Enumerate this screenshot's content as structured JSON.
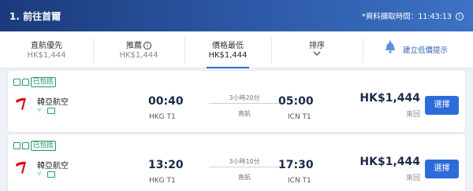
{
  "header": {
    "title": "1. 前往首爾",
    "fetch_time": "*資料擷取時間：11:43:13",
    "fetch_time_icon": "info-icon"
  },
  "filters": [
    {
      "label": "直航優先",
      "price": "HK$1,444"
    },
    {
      "label": "推薦",
      "price": "HK$1,444",
      "icon": "info-icon"
    },
    {
      "label": "價格最低",
      "price": "HK$1,444",
      "active": true
    },
    {
      "label": "排序",
      "icon": "chevron-down-icon"
    }
  ],
  "price_alert": {
    "label": "建立低價提示",
    "icon": "bell-icon"
  },
  "colors": {
    "accent": "#2c6bd9",
    "header": "#1b3a7a",
    "green": "#2a9a6a",
    "tway_red": "#e3001b"
  },
  "flights": [
    {
      "badge": "已包括",
      "airline": "韓亞航空",
      "amenities": [
        "meal-icon",
        "entertainment-icon"
      ],
      "depart_time": "00:40",
      "depart_airport": "HKG T1",
      "duration": "3小時20分",
      "stops": "直航",
      "arrive_time": "05:00",
      "arrive_airport": "ICN T1",
      "price": "HK$1,444",
      "trip_type": "來回",
      "select_label": "選擇"
    },
    {
      "badge": "已包括",
      "airline": "韓亞航空",
      "amenities": [
        "meal-icon",
        "entertainment-icon"
      ],
      "depart_time": "13:20",
      "depart_airport": "HKG T1",
      "duration": "3小時10分",
      "stops": "直航",
      "arrive_time": "17:30",
      "arrive_airport": "ICN T1",
      "price": "HK$1,444",
      "trip_type": "來回",
      "select_label": "選擇"
    }
  ]
}
